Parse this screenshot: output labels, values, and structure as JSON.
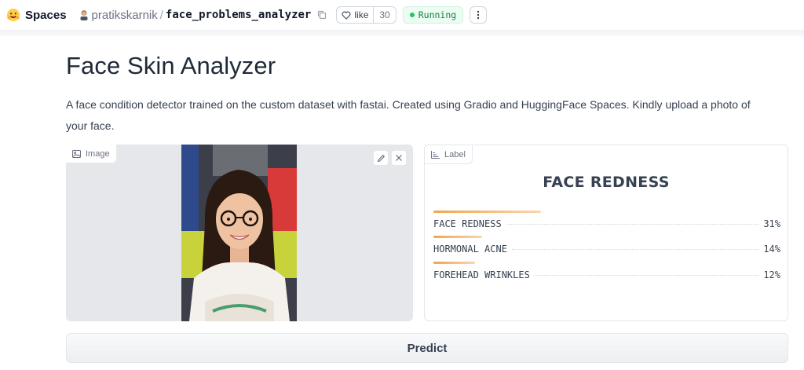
{
  "header": {
    "logo_icon": "hugging-face-icon",
    "spaces_label": "Spaces",
    "owner": "pratikskarnik",
    "separator": "/",
    "repo_name": "face_problems_analyzer",
    "like_label": "like",
    "like_count": "30",
    "status_label": "Running",
    "status_color": "#22c55e"
  },
  "app": {
    "title": "Face Skin Analyzer",
    "description": "A face condition detector trained on the custom dataset with fastai. Created using Gradio and HuggingFace Spaces. Kindly upload a photo of your face."
  },
  "image_input": {
    "tag_label": "Image",
    "tag_icon": "image-icon",
    "edit_icon": "pencil-icon",
    "clear_icon": "close-icon"
  },
  "label_output": {
    "tag_label": "Label",
    "tag_icon": "bar-chart-icon",
    "top_label": "FACE REDNESS",
    "confidences": [
      {
        "label": "FACE REDNESS",
        "value": "31%",
        "fraction": 0.31
      },
      {
        "label": "HORMONAL ACNE",
        "value": "14%",
        "fraction": 0.14
      },
      {
        "label": "FOREHEAD WRINKLES",
        "value": "12%",
        "fraction": 0.12
      }
    ],
    "bar_color": "#f2a64a"
  },
  "predict_button": {
    "label": "Predict"
  }
}
